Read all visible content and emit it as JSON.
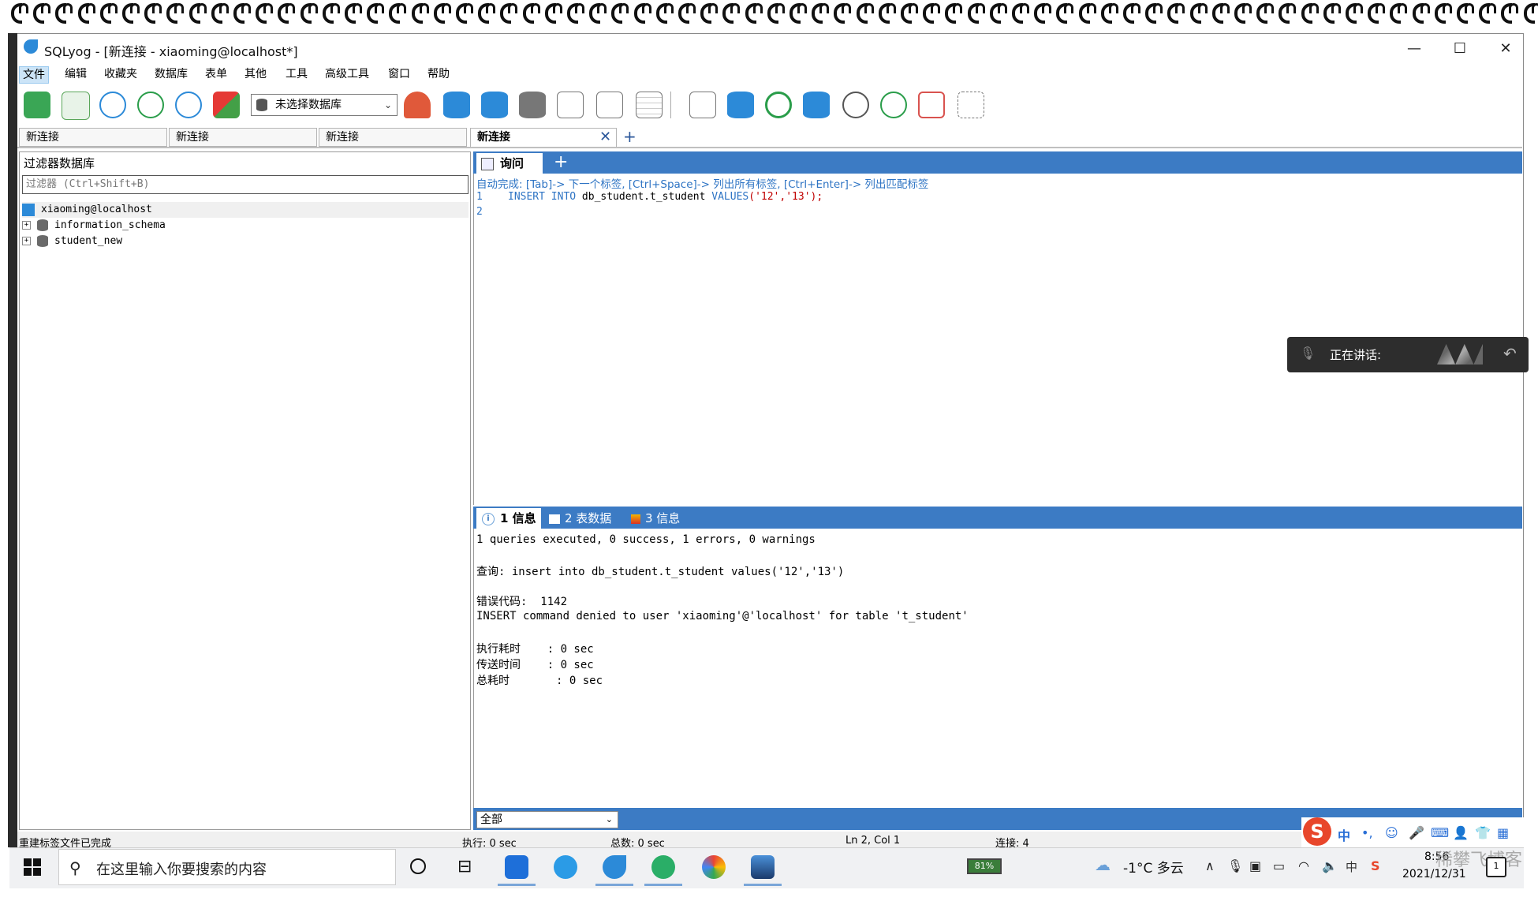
{
  "window": {
    "title": "SQLyog - [新连接 - xiaoming@localhost*]"
  },
  "menu": [
    "文件",
    "编辑",
    "收藏夹",
    "数据库",
    "表单",
    "其他",
    "工具",
    "高级工具",
    "窗口",
    "帮助"
  ],
  "toolbar": {
    "db_select": "未选择数据库"
  },
  "conn_tabs": [
    "新连接",
    "新连接",
    "新连接",
    "新连接"
  ],
  "left_panel": {
    "title": "过滤器数据库",
    "filter_placeholder": "过滤器 (Ctrl+Shift+B)",
    "tree": [
      "xiaoming@localhost",
      "information_schema",
      "student_new"
    ]
  },
  "query": {
    "tab_label": "询问",
    "add": "+",
    "autocomplete": "自动完成: [Tab]-> 下一个标签, [Ctrl+Space]-> 列出所有标签, [Ctrl+Enter]-> 列出匹配标签",
    "line1_num": "1",
    "line1_kw1": "INSERT INTO",
    "line1_table": " db_student.t_student ",
    "line1_kw2": "VALUES",
    "line1_vals": "('12','13');",
    "line2_num": "2"
  },
  "overlay": {
    "label": "正在讲话:"
  },
  "results": {
    "tab1": "1 信息",
    "tab2": "2 表数据",
    "tab3": "3 信息",
    "lines": [
      "1 queries executed, 0 success, 1 errors, 0 warnings",
      "查询: insert into db_student.t_student values('12','13')",
      "错误代码:  1142",
      "INSERT command denied to user 'xiaoming'@'localhost' for table 't_student'",
      "执行耗时    : 0 sec",
      "传送时间    : 0 sec",
      "总耗时       : 0 sec"
    ],
    "filter": "全部"
  },
  "statusbar": {
    "left": "重建标签文件已完成",
    "exec": "执行: 0 sec",
    "total": "总数: 0 sec",
    "pos": "Ln 2, Col 1",
    "conn": "连接: 4"
  },
  "ime": {
    "lang": "中"
  },
  "taskbar": {
    "search_placeholder": "在这里输入你要搜索的内容",
    "battery": "81%",
    "weather": "-1°C  多云",
    "ime_lang": "中",
    "time": "8:56",
    "date": "2021/12/31",
    "watermark": "稀攀飞博客",
    "notifications": "1"
  },
  "colors": {
    "accent": "#3c7bc4",
    "keyword": "#2e74c4",
    "string": "#c00000"
  }
}
